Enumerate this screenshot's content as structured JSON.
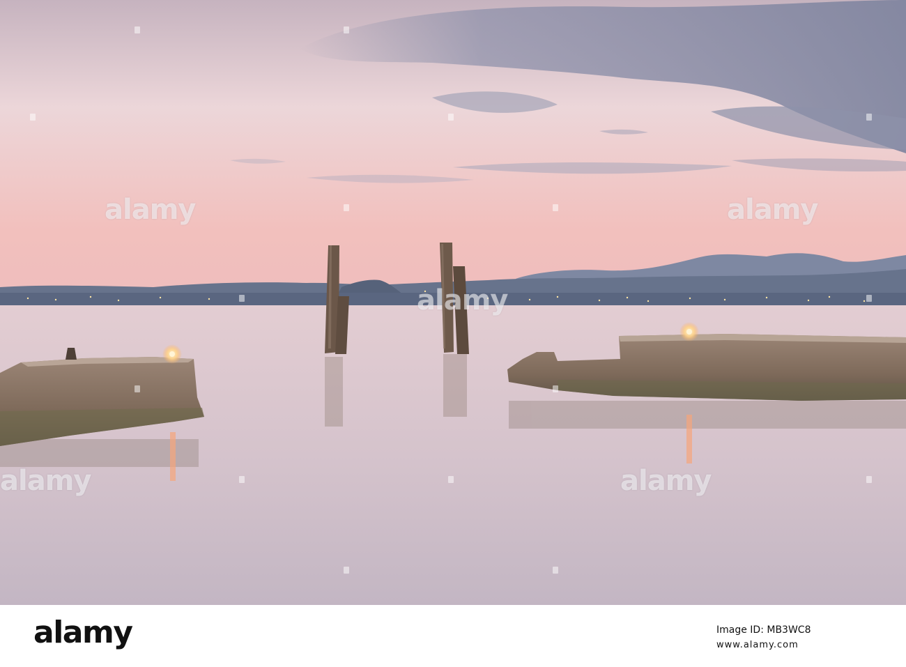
{
  "photo": {
    "subject": "lake-at-dusk",
    "elements": [
      "twilight-sky",
      "distant-mountains",
      "shoreline-lights",
      "wooden-mooring-posts",
      "stone-pier-left",
      "stone-pier-right",
      "pier-lamps",
      "calm-water-reflections"
    ]
  },
  "watermark": {
    "text": "alamy"
  },
  "footer": {
    "brand": "alamy",
    "image_id_label": "Image ID: MB3WC8",
    "site": "www.alamy.com"
  },
  "colors": {
    "sky_top": "#b9a3b2",
    "sky_horizon": "#eeb3b2",
    "water": "#d6c3cc",
    "mountains": "#6b7892",
    "stone": "#8a7563",
    "lamp": "#ffd9a0"
  }
}
